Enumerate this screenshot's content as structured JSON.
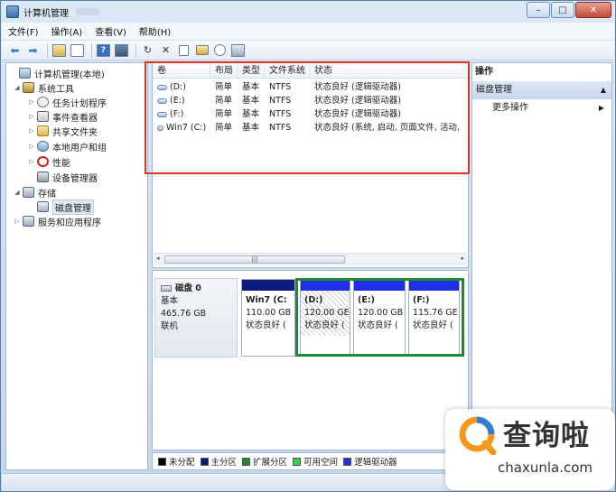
{
  "window": {
    "title": "计算机管理"
  },
  "titlebar": {
    "minimize": "–",
    "maximize": "□",
    "close": "✕"
  },
  "menu": [
    "文件(F)",
    "操作(A)",
    "查看(V)",
    "帮助(H)"
  ],
  "toolbar": {
    "back": "⬅",
    "forward": "➡",
    "refresh": "↻",
    "delete": "✕",
    "help": "?"
  },
  "tree": [
    {
      "label": "计算机管理(本地)",
      "icon": "computer-icon",
      "expander": ""
    },
    {
      "label": "系统工具",
      "icon": "tools-icon",
      "expander": "◢"
    },
    {
      "label": "任务计划程序",
      "icon": "clock-icon",
      "expander": "▷"
    },
    {
      "label": "事件查看器",
      "icon": "event-viewer-icon",
      "expander": "▷"
    },
    {
      "label": "共享文件夹",
      "icon": "folder-icon",
      "expander": "▷"
    },
    {
      "label": "本地用户和组",
      "icon": "users-icon",
      "expander": "▷"
    },
    {
      "label": "性能",
      "icon": "performance-icon",
      "expander": "▷"
    },
    {
      "label": "设备管理器",
      "icon": "device-manager-icon",
      "expander": ""
    },
    {
      "label": "存储",
      "icon": "storage-icon",
      "expander": "◢"
    },
    {
      "label": "磁盘管理",
      "icon": "disk-management-icon",
      "expander": ""
    },
    {
      "label": "服务和应用程序",
      "icon": "services-icon",
      "expander": "▷"
    }
  ],
  "volumes": {
    "columns": [
      "卷",
      "布局",
      "类型",
      "文件系统",
      "状态"
    ],
    "rows": [
      [
        "(D:)",
        "简单",
        "基本",
        "NTFS",
        "状态良好 (逻辑驱动器)"
      ],
      [
        "(E:)",
        "简单",
        "基本",
        "NTFS",
        "状态良好 (逻辑驱动器)"
      ],
      [
        "(F:)",
        "简单",
        "基本",
        "NTFS",
        "状态良好 (逻辑驱动器)"
      ],
      [
        "Win7 (C:)",
        "简单",
        "基本",
        "NTFS",
        "状态良好 (系统, 启动, 页面文件, 活动,"
      ]
    ],
    "scroll_left": "◂",
    "scroll_right": "▸",
    "scroll_thumb": "|||"
  },
  "disk": {
    "name": "磁盘 0",
    "type": "基本",
    "size": "465.76 GB",
    "status": "联机",
    "partitions": [
      {
        "name": "Win7 (C:",
        "size": "110.00 GB",
        "status": "状态良好 (",
        "bar_color": "#0c1a80"
      },
      {
        "name": "(D:)",
        "size": "120.00 GE",
        "status": "状态良好 (",
        "bar_color": "#1f2fe6"
      },
      {
        "name": "(E:)",
        "size": "120.00 GB",
        "status": "状态良好 (",
        "bar_color": "#1f2fe6"
      },
      {
        "name": "(F:)",
        "size": "115.76 GE",
        "status": "状态良好 (",
        "bar_color": "#1f2fe6"
      }
    ]
  },
  "legend": [
    {
      "label": "未分配",
      "color": "#000000"
    },
    {
      "label": "主分区",
      "color": "#0c1a80"
    },
    {
      "label": "扩展分区",
      "color": "#1f8a2e"
    },
    {
      "label": "可用空间",
      "color": "#37d24a"
    },
    {
      "label": "逻辑驱动器",
      "color": "#1f2fe6"
    }
  ],
  "actions": {
    "title": "操作",
    "section": "磁盘管理",
    "section_caret": "▲",
    "more": "更多操作",
    "more_caret": "▶"
  },
  "watermark": {
    "brand": "查询啦",
    "site": "chaxunla.com"
  },
  "colors": {
    "red_highlight": "#d9342b",
    "green_highlight": "#1f8a2e",
    "logo_orange": "#f39a1e",
    "logo_blue": "#2f7fd6"
  }
}
